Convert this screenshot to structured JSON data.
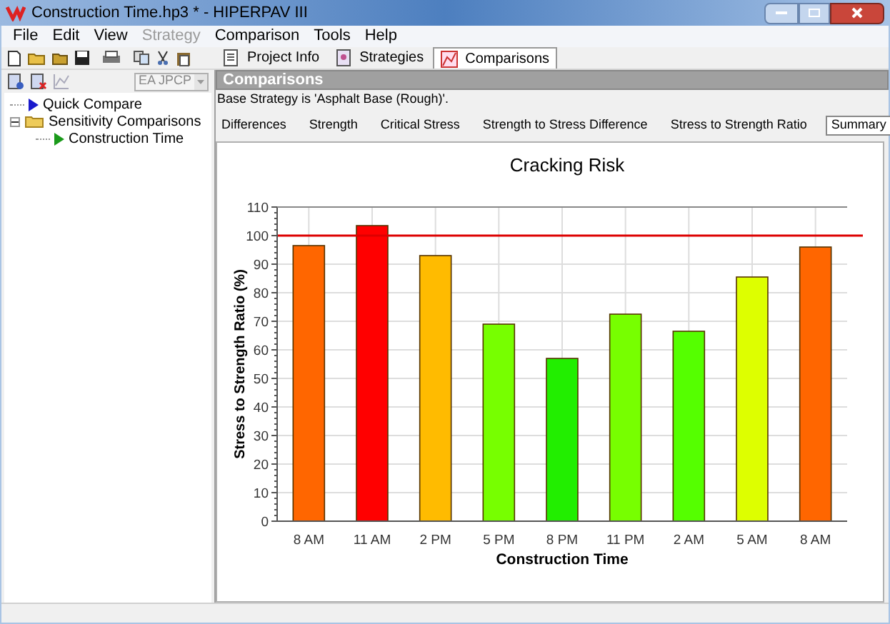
{
  "window": {
    "title": "Construction Time.hp3 * - HIPERPAV III"
  },
  "menu": [
    {
      "label": "File",
      "disabled": false
    },
    {
      "label": "Edit",
      "disabled": false
    },
    {
      "label": "View",
      "disabled": false
    },
    {
      "label": "Strategy",
      "disabled": true
    },
    {
      "label": "Comparison",
      "disabled": false
    },
    {
      "label": "Tools",
      "disabled": false
    },
    {
      "label": "Help",
      "disabled": false
    }
  ],
  "view_tabs": [
    {
      "label": "Project Info",
      "selected": false
    },
    {
      "label": "Strategies",
      "selected": false
    },
    {
      "label": "Comparisons",
      "selected": true
    }
  ],
  "strategy_select": {
    "value": "EA JPCP"
  },
  "tree": [
    {
      "label": "Quick Compare"
    },
    {
      "label": "Sensitivity Comparisons",
      "expanded": true,
      "children": [
        {
          "label": "Construction Time"
        }
      ]
    }
  ],
  "panel": {
    "title": "Comparisons",
    "base_strategy": "Base Strategy is 'Asphalt Base (Rough)'."
  },
  "tabs": [
    {
      "label": "Differences",
      "selected": false
    },
    {
      "label": "Strength",
      "selected": false
    },
    {
      "label": "Critical Stress",
      "selected": false
    },
    {
      "label": "Strength to Stress Difference",
      "selected": false
    },
    {
      "label": "Stress to Strength Ratio",
      "selected": false
    },
    {
      "label": "Summary",
      "selected": true
    }
  ],
  "chart_data": {
    "type": "bar",
    "title": "Cracking Risk",
    "xlabel": "Construction Time",
    "ylabel": "Stress to Strength Ratio (%)",
    "categories": [
      "8 AM",
      "11 AM",
      "2 PM",
      "5 PM",
      "8 PM",
      "11 PM",
      "2 AM",
      "5 AM",
      "8 AM"
    ],
    "series": [
      {
        "colors": [
          "#ff6600",
          "#ff0000",
          "#ffbb00",
          "#77ff00",
          "#22ee00",
          "#77ff00",
          "#55ff00",
          "#ddff00",
          "#ff6600"
        ],
        "values": [
          96.5,
          103.5,
          93,
          69,
          57,
          72.5,
          66.5,
          85.5,
          96
        ]
      }
    ],
    "ylim": [
      0,
      110
    ],
    "yticks": [
      0,
      10,
      20,
      30,
      40,
      50,
      60,
      70,
      80,
      90,
      100,
      110
    ],
    "grid": true,
    "ref_lines": [
      {
        "axis": "y",
        "value": 100,
        "color": "#dd0000"
      }
    ]
  }
}
